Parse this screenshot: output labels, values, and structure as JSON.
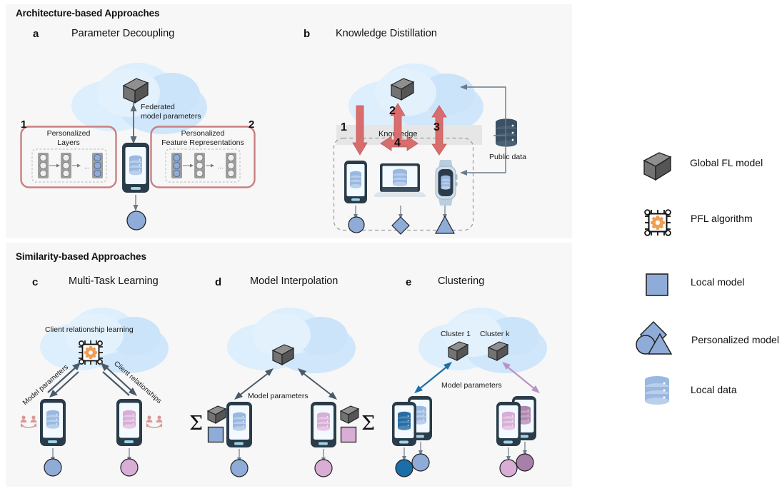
{
  "figure": {
    "type": "diagram",
    "topic": "Personalized Federated Learning (PFL) approaches"
  },
  "sections": [
    {
      "id": "architecture",
      "title": "Architecture-based Approaches"
    },
    {
      "id": "similarity",
      "title": "Similarity-based Approaches"
    }
  ],
  "panels": {
    "a": {
      "letter": "a",
      "title": "Parameter Decoupling",
      "arrow_label_line1": "Federated",
      "arrow_label_line2": "model parameters",
      "box1": {
        "number": "1",
        "label_line1": "Personalized",
        "label_line2": "Layers"
      },
      "box2": {
        "number": "2",
        "label_line1": "Personalized",
        "label_line2": "Feature Representations"
      },
      "ellipsis": "..."
    },
    "b": {
      "letter": "b",
      "title": "Knowledge Distillation",
      "band_label": "Knowledge",
      "steps": [
        "1",
        "2",
        "3",
        "4"
      ],
      "public_data_label": "Public data"
    },
    "c": {
      "letter": "c",
      "title": "Multi-Task Learning",
      "cloud_label": "Client relationship learning",
      "arrow_left_label": "Model parameters",
      "arrow_right_label": "Client relationships"
    },
    "d": {
      "letter": "d",
      "title": "Model Interpolation",
      "arrow_label": "Model parameters",
      "sigma": "Σ"
    },
    "e": {
      "letter": "e",
      "title": "Clustering",
      "cluster1_label": "Cluster 1",
      "clusterk_label": "Cluster k",
      "arrow_label": "Model parameters"
    }
  },
  "legend": {
    "items": [
      {
        "icon": "grey-cube-icon",
        "label": "Global FL model"
      },
      {
        "icon": "chip-gear-icon",
        "label": "PFL algorithm"
      },
      {
        "icon": "blue-square-icon",
        "label": "Local model"
      },
      {
        "icon": "circle-diamond-triangle-icon",
        "label": "Personalized model"
      },
      {
        "icon": "database-icon",
        "label": "Local data"
      }
    ]
  },
  "colors": {
    "panel_bg": "#f7f7f7",
    "cloud_light": "#ddeefc",
    "cloud_mid": "#cbe4fa",
    "cube_top": "#8c8c8c",
    "cube_front": "#6e6e6e",
    "cube_side": "#4f4f4f",
    "red_arrow": "#d96c6c",
    "red_box_border": "#c98080",
    "blue_model": "#8fabd8",
    "pink_model": "#d9aed6",
    "dark_blue": "#1b6ea8",
    "device_dark": "#2a3b49",
    "db_blue": "#9ab8e0",
    "db_pink": "#d7aed6",
    "db_navy": "#3c5063",
    "chip_orange": "#ef9e54",
    "arrow_grey": "#5a6a78",
    "knowledge_band": "#e6e6e6"
  }
}
